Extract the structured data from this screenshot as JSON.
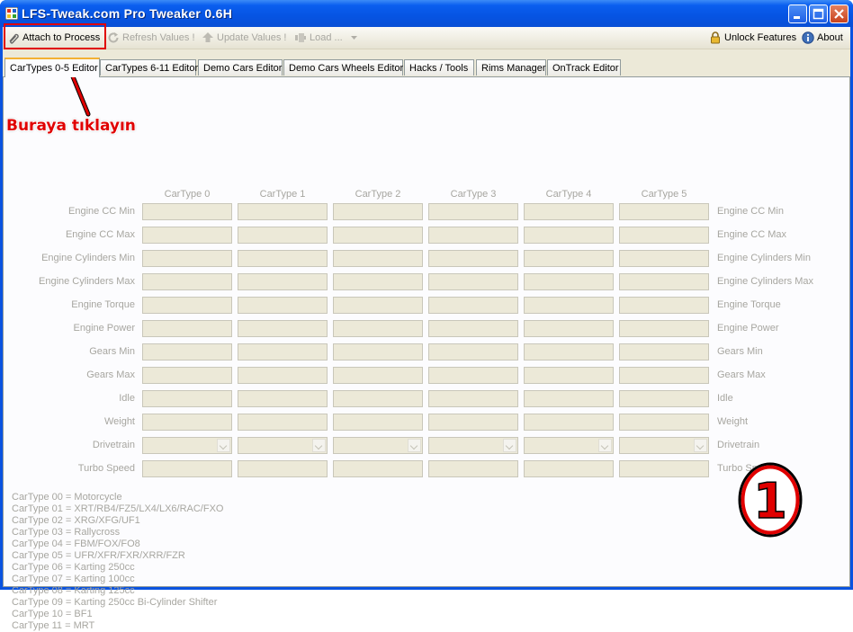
{
  "window": {
    "title": "LFS-Tweak.com Pro Tweaker 0.6H",
    "accent": "#0A53E0"
  },
  "toolbar": {
    "attach_label": "Attach to Process",
    "refresh_label": "Refresh Values !",
    "update_label": "Update Values !",
    "load_label": "Load ...",
    "unlock_label": "Unlock Features",
    "about_label": "About"
  },
  "tabs": [
    {
      "label": "CarTypes 0-5 Editor",
      "active": true
    },
    {
      "label": "CarTypes 6-11 Editor"
    },
    {
      "label": "Demo Cars Editor"
    },
    {
      "label": "Demo Cars Wheels Editor"
    },
    {
      "label": "Hacks / Tools"
    },
    {
      "label": "Rims Manager"
    },
    {
      "label": "OnTrack Editor"
    }
  ],
  "annotation": {
    "text": "Buraya tıklayın",
    "number": "1",
    "color": "#E00000"
  },
  "columns": [
    "CarType 0",
    "CarType 1",
    "CarType 2",
    "CarType 3",
    "CarType 4",
    "CarType 5"
  ],
  "rows": [
    {
      "label": "Engine CC Min",
      "kind": "text"
    },
    {
      "label": "Engine CC Max",
      "kind": "text"
    },
    {
      "label": "Engine Cylinders Min",
      "kind": "text"
    },
    {
      "label": "Engine Cylinders Max",
      "kind": "text"
    },
    {
      "label": "Engine Torque",
      "kind": "text"
    },
    {
      "label": "Engine Power",
      "kind": "text"
    },
    {
      "label": "Gears Min",
      "kind": "text"
    },
    {
      "label": "Gears Max",
      "kind": "text"
    },
    {
      "label": "Idle",
      "kind": "text"
    },
    {
      "label": "Weight",
      "kind": "text"
    },
    {
      "label": "Drivetrain",
      "kind": "combo"
    },
    {
      "label": "Turbo Speed",
      "kind": "text"
    }
  ],
  "cartype_notes": [
    "CarType 00 = Motorcycle",
    "CarType 01 = XRT/RB4/FZ5/LX4/LX6/RAC/FXO",
    "CarType 02 = XRG/XFG/UF1",
    "CarType 03 = Rallycross",
    "CarType 04 = FBM/FOX/FO8",
    "CarType 05 = UFR/XFR/FXR/XRR/FZR",
    "CarType 06 = Karting 250cc",
    "CarType 07 = Karting 100cc",
    "CarType 08 = Karting 125cc",
    "CarType 09 = Karting 250cc Bi-Cylinder Shifter",
    "CarType 10 = BF1",
    "CarType 11 = MRT"
  ]
}
